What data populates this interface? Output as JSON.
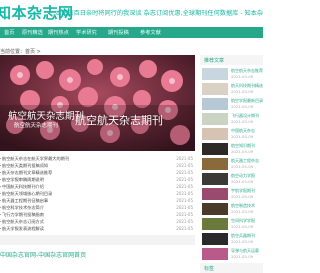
{
  "header": {
    "logo": "知本杂志网",
    "tagline": "本站的百日亲时将同行的我深谈 杂志订阅优惠,全球期刊任何数据库 - 知本杂志"
  },
  "nav": {
    "items": [
      "首页",
      "原刊精选",
      "期刊热点",
      "学术研究",
      "期刊投稿",
      "参考文献"
    ]
  },
  "breadcrumb": "当前位置：首页 > ",
  "slider": {
    "caption": "航空航天杂志期刊",
    "big_title": "航空航天杂志期刊",
    "sub_caption": "航空航天杂志期刊"
  },
  "list": {
    "rows": [
      {
        "title": "航空航天杂志在航天学界最大的期刊",
        "date": "2021-05"
      },
      {
        "title": "航空航天类期刊投稿须知",
        "date": "2021-05"
      },
      {
        "title": "航天杂志期刊文章精选推荐",
        "date": "2021-05"
      },
      {
        "title": "航空学报审稿周期说明",
        "date": "2021-05"
      },
      {
        "title": "中国航天科技期刊介绍",
        "date": "2021-05"
      },
      {
        "title": "航空航天领域核心期刊目录",
        "date": "2021-05"
      },
      {
        "title": "航天器工程期刊征稿启事",
        "date": "2021-05"
      },
      {
        "title": "航空科学技术杂志简介",
        "date": "2021-05"
      },
      {
        "title": "飞行力学期刊投稿指南",
        "date": "2021-05"
      },
      {
        "title": "航空航天杂志订阅方式",
        "date": "2021-05"
      },
      {
        "title": "航天学报发表流程解读",
        "date": "2021-05"
      }
    ]
  },
  "footer_link": "中国杂志官网-中国杂志官网首页",
  "sidebar": {
    "section1": "推荐文章",
    "items": [
      {
        "title": "航空航天杂志推荐",
        "date": "2021-05-09"
      },
      {
        "title": "航天科技期刊精选",
        "date": "2021-05-09"
      },
      {
        "title": "航空学报最新目录",
        "date": "2021-05-09"
      },
      {
        "title": "飞行器设计期刊",
        "date": "2021-05-09"
      },
      {
        "title": "中国航天杂志",
        "date": "2021-05-09"
      },
      {
        "title": "航空知识期刊",
        "date": "2021-05-09"
      },
      {
        "title": "航天器工程杂志",
        "date": "2021-05-09"
      },
      {
        "title": "航空动力学报",
        "date": "2021-05-09"
      },
      {
        "title": "宇航学报期刊",
        "date": "2021-05-09"
      },
      {
        "title": "航空制造技术",
        "date": "2021-05-09"
      },
      {
        "title": "空间科学学报",
        "date": "2021-05-09"
      },
      {
        "title": "航空兵器期刊",
        "date": "2021-05-09"
      },
      {
        "title": "导弹与航天运载",
        "date": "2021-05-09"
      }
    ],
    "section2": "标签"
  },
  "colors": {
    "accent": "#27a88a",
    "logo": "#14b8a6"
  }
}
